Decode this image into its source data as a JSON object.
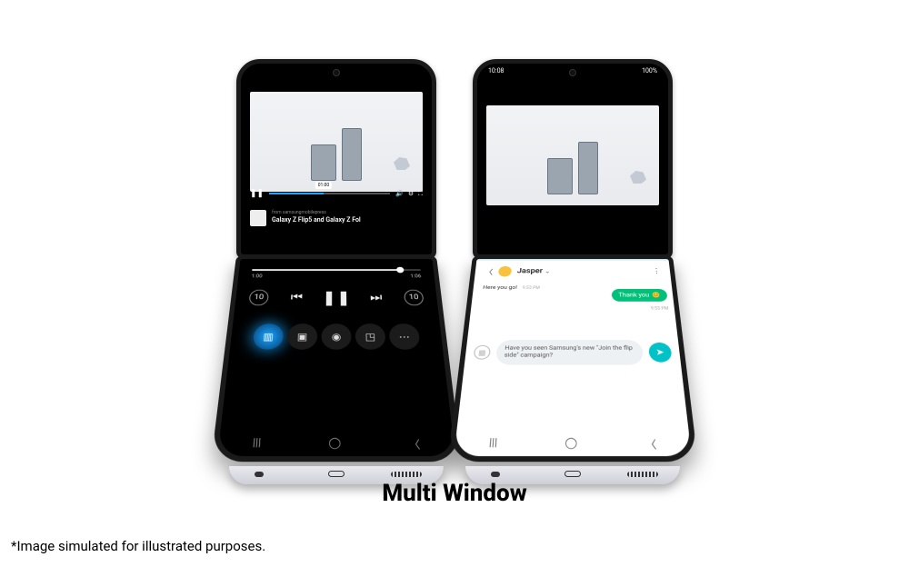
{
  "feature_title": "Multi Window",
  "disclaimer": "*Image simulated for illustrated purposes.",
  "left_phone": {
    "scrub_chip": "01:00",
    "video": {
      "from_prefix": "from",
      "from": "samsungmobilepress",
      "title": "Galaxy Z Flip5 and Galaxy Z Fol"
    },
    "player": {
      "time_current": "1:00",
      "time_total": "1:06",
      "rewind_label": "10",
      "forward_label": "10"
    }
  },
  "right_phone": {
    "status": {
      "time": "10:08",
      "battery": "100%"
    },
    "chat": {
      "name": "Jasper",
      "msg_out_text": "Here you go!",
      "msg_out_time": "9:53 PM",
      "reply_text": "Thank you",
      "reply_time": "9:53 PM",
      "input_text": "Have you seen Samsung's new \"Join the flip side\" campaign?"
    }
  }
}
